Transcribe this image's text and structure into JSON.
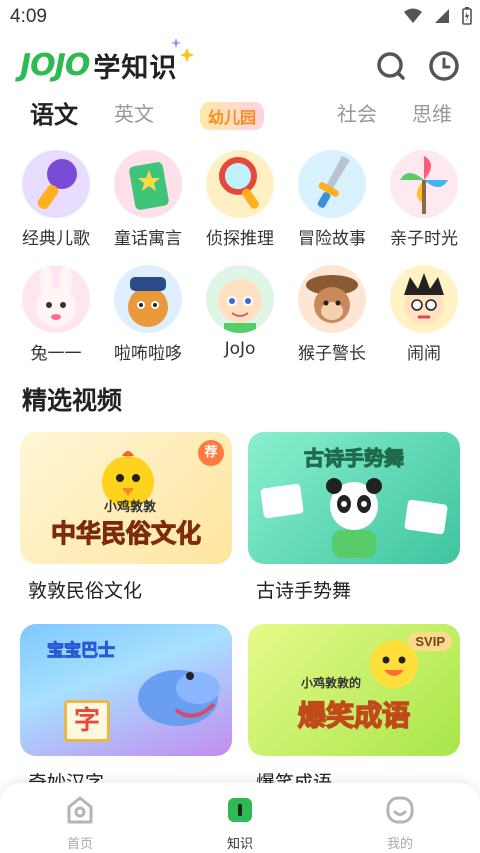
{
  "status_bar": {
    "time": "4:09"
  },
  "header": {
    "logo_brand": "JOJO",
    "logo_text": "学知识"
  },
  "tabs": [
    {
      "label": "语文",
      "active": true
    },
    {
      "label": "英文",
      "active": false
    },
    {
      "label": "幼儿园",
      "active": false
    },
    {
      "label": "社会",
      "active": false
    },
    {
      "label": "思维",
      "active": false
    }
  ],
  "categories": [
    {
      "label": "经典儿歌",
      "icon": "microphone-icon"
    },
    {
      "label": "童话寓言",
      "icon": "storybook-icon"
    },
    {
      "label": "侦探推理",
      "icon": "magnifier-icon"
    },
    {
      "label": "冒险故事",
      "icon": "sword-icon"
    },
    {
      "label": "亲子时光",
      "icon": "pinwheel-icon"
    },
    {
      "label": "兔一一",
      "icon": "rabbit-character"
    },
    {
      "label": "啦咘啦哆",
      "icon": "police-dog-character"
    },
    {
      "label": "JoJo",
      "icon": "jojo-baby-character"
    },
    {
      "label": "猴子警长",
      "icon": "monkey-detective-character"
    },
    {
      "label": "闹闹",
      "icon": "naonao-character"
    }
  ],
  "section": {
    "title": "精选视频"
  },
  "videos": [
    {
      "title": "敦敦民俗文化",
      "art_line1": "小鸡敦敦",
      "art_line2": "中华民俗文化",
      "badge": "荐",
      "colors": [
        "#fff2c4",
        "#ffe08a"
      ]
    },
    {
      "title": "古诗手势舞",
      "art_line1": "古诗手势舞",
      "art_line2": "",
      "badge": "",
      "colors": [
        "#7fe3c5",
        "#3fbf9c"
      ]
    },
    {
      "title": "奇妙汉字",
      "art_line1": "宝宝巴士",
      "art_line2": "字",
      "badge": "",
      "colors": [
        "#7ec3ff",
        "#c28cf0"
      ]
    },
    {
      "title": "爆笑成语",
      "art_line1": "小鸡敦敦的",
      "art_line2": "爆笑成语",
      "badge": "SVIP",
      "colors": [
        "#d9f57a",
        "#9ee24f"
      ]
    }
  ],
  "bottom_nav": [
    {
      "label": "首页",
      "icon": "home-icon",
      "active": false
    },
    {
      "label": "知识",
      "icon": "book-icon",
      "active": true
    },
    {
      "label": "我的",
      "icon": "profile-face-icon",
      "active": false
    }
  ],
  "colors": {
    "brand_green": "#2eba52",
    "active_nav": "#2eba52"
  }
}
